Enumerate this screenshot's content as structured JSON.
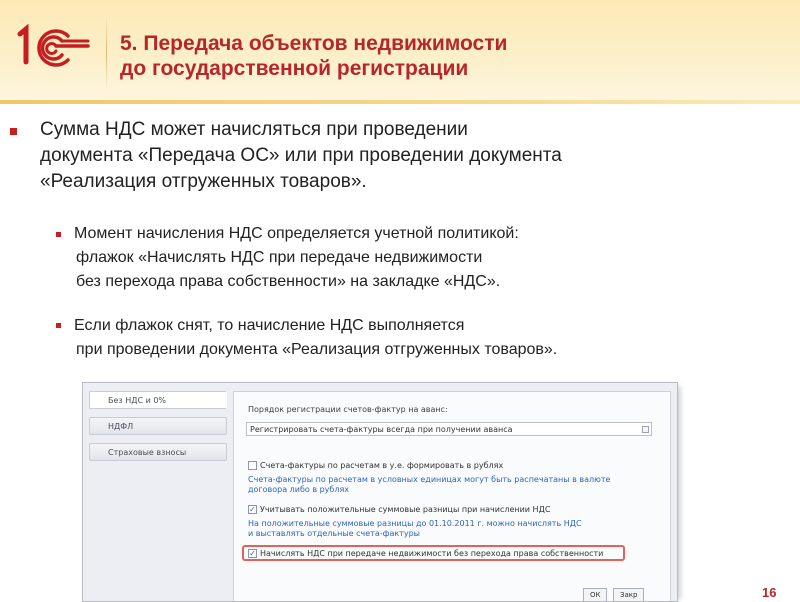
{
  "header": {
    "logo": "1С",
    "title_line1": "5. Передача объектов недвижимости",
    "title_line2": "до государственной регистрации"
  },
  "bullets": {
    "main": {
      "line1": "Сумма НДС может начисляться при проведении",
      "line2": "документа «Передача ОС» или при проведении документа",
      "line3": "«Реализация отгруженных товаров»."
    },
    "sub1": {
      "line1": "Момент начисления НДС определяется учетной политикой:",
      "line2": "флажок «Начислять НДС при передаче недвижимости",
      "line3": "без перехода права собственности» на закладке «НДС»."
    },
    "sub2": {
      "line1": "Если флажок снят, то начисление НДС выполняется",
      "line2": "при проведении документа «Реализация отгруженных товаров»."
    }
  },
  "screenshot": {
    "tabs": [
      "Без НДС и 0%",
      "НДФЛ",
      "Страховые взносы"
    ],
    "advance_label": "Порядок регистрации счетов-фактур на аванс:",
    "advance_value": "Регистрировать счета-фактуры всегда при получении аванса",
    "chk1_label": "Счета-фактуры по расчетам в у.е. формировать в рублях",
    "chk1_checked": "",
    "hint1_line1": "Счета-фактуры по расчетам в условных единицах могут быть распечатаны в валюте",
    "hint1_line2": "договора либо в рублях",
    "chk2_label": "Учитывать положительные суммовые разницы при начислении НДС",
    "chk2_checked": "✓",
    "hint2_line1": "На положительные суммовые разницы до 01.10.2011 г. можно начислять НДС",
    "hint2_line2": "и выставлять отдельные счета-фактуры",
    "chk3_label": "Начислять НДС при передаче недвижимости без перехода права собственности",
    "chk3_checked": "✓",
    "ok_label": "ОК",
    "cancel_label": "Закр"
  },
  "page_number": "16",
  "colors": {
    "accent_red": "#b7262b",
    "header_bg": "#fde9b7",
    "hint_blue": "#2f64b8",
    "highlight": "#e2615a"
  }
}
